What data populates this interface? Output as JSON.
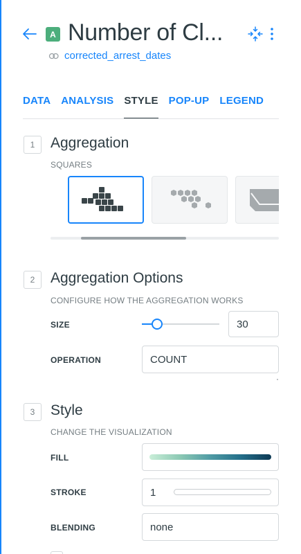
{
  "header": {
    "layer_letter": "A",
    "layer_color": "#4cae7c",
    "title": "Number of Cl...",
    "source": "corrected_arrest_dates",
    "back_icon": "arrow-left-icon",
    "compress_icon": "compress-icon",
    "more_icon": "more-vertical-icon",
    "source_icon": "link-icon"
  },
  "tabs": [
    {
      "label": "DATA",
      "active": false
    },
    {
      "label": "ANALYSIS",
      "active": false
    },
    {
      "label": "STYLE",
      "active": true
    },
    {
      "label": "POP-UP",
      "active": false
    },
    {
      "label": "LEGEND",
      "active": false
    }
  ],
  "sections": {
    "aggregation": {
      "step": "1",
      "title": "Aggregation",
      "subtitle": "SQUARES",
      "options": [
        {
          "name": "squares",
          "selected": true
        },
        {
          "name": "hexagons",
          "selected": false
        },
        {
          "name": "boundaries",
          "selected": false
        }
      ]
    },
    "aggregation_options": {
      "step": "2",
      "title": "Aggregation Options",
      "subtitle": "CONFIGURE HOW THE AGGREGATION WORKS",
      "size_label": "SIZE",
      "size_value": "30",
      "size_slider_fraction": 0.2,
      "operation_label": "OPERATION",
      "operation_value": "COUNT"
    },
    "style": {
      "step": "3",
      "title": "Style",
      "subtitle": "CHANGE THE VISUALIZATION",
      "fill_label": "FILL",
      "stroke_label": "STROKE",
      "stroke_value": "1",
      "blending_label": "BLENDING",
      "blending_value": "none"
    }
  },
  "colors": {
    "accent": "#1785fb",
    "text": "#2e3c43",
    "muted": "#747d82",
    "ramp": [
      "#c9eed8",
      "#8cc9b4",
      "#4f9ba4",
      "#246f8a",
      "#0e3a55"
    ]
  }
}
